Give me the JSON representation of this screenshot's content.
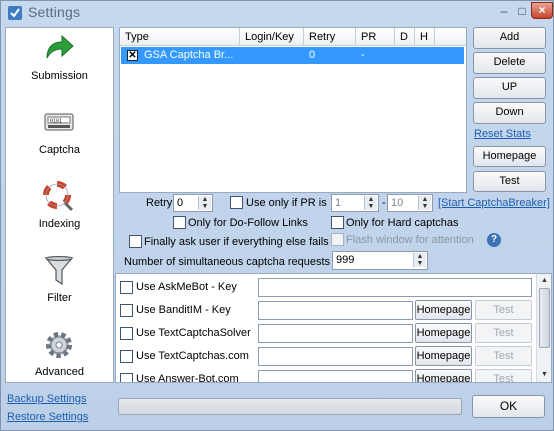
{
  "window": {
    "title": "Settings"
  },
  "sidebar": {
    "items": [
      {
        "label": "Submission",
        "icon": "green-arrow-icon"
      },
      {
        "label": "Captcha",
        "icon": "captcha-icon"
      },
      {
        "label": "Indexing",
        "icon": "lifebuoy-icon"
      },
      {
        "label": "Filter",
        "icon": "funnel-icon"
      },
      {
        "label": "Advanced",
        "icon": "gear-icon"
      }
    ],
    "backup_label": "Backup Settings",
    "restore_label": "Restore Settings"
  },
  "captcha_list": {
    "columns": [
      "Type",
      "Login/Key",
      "Retry",
      "PR",
      "D",
      "H"
    ],
    "rows": [
      {
        "checked": true,
        "type": "GSA Captcha Br...",
        "login_key": "",
        "retry": "0",
        "pr": "-",
        "d": "",
        "h": ""
      }
    ]
  },
  "side_buttons": {
    "add": "Add",
    "delete": "Delete",
    "up": "UP",
    "down": "Down",
    "reset_stats": "Reset Stats",
    "homepage": "Homepage",
    "test": "Test"
  },
  "options": {
    "retry_label": "Retry",
    "retry_value": "0",
    "use_only_pr_label": "Use only if PR is",
    "pr_min": "1",
    "pr_sep": "-",
    "pr_max": "10",
    "start_breaker_link": "[Start CaptchaBreaker]",
    "dofollow_label": "Only for Do-Follow Links",
    "hard_captchas_label": "Only for Hard captchas",
    "finally_ask_label": "Finally ask user if everything else fails",
    "flash_window_label": "Flash window for attention",
    "simultaneous_label": "Number of simultaneous captcha requests",
    "simultaneous_value": "999"
  },
  "services": [
    {
      "label": "Use AskMeBot - Key",
      "has_buttons": false
    },
    {
      "label": "Use BanditIM - Key",
      "has_buttons": true
    },
    {
      "label": "Use TextCaptchaSolver",
      "has_buttons": true
    },
    {
      "label": "Use TextCaptchas.com",
      "has_buttons": true
    },
    {
      "label": "Use Answer-Bot.com",
      "has_buttons": true
    }
  ],
  "service_buttons": {
    "homepage": "Homepage",
    "test": "Test"
  },
  "footer": {
    "ok": "OK"
  },
  "colors": {
    "selection": "#3399ff",
    "link": "#1e5eb0",
    "accent_arrow": "#2c9e3a"
  }
}
